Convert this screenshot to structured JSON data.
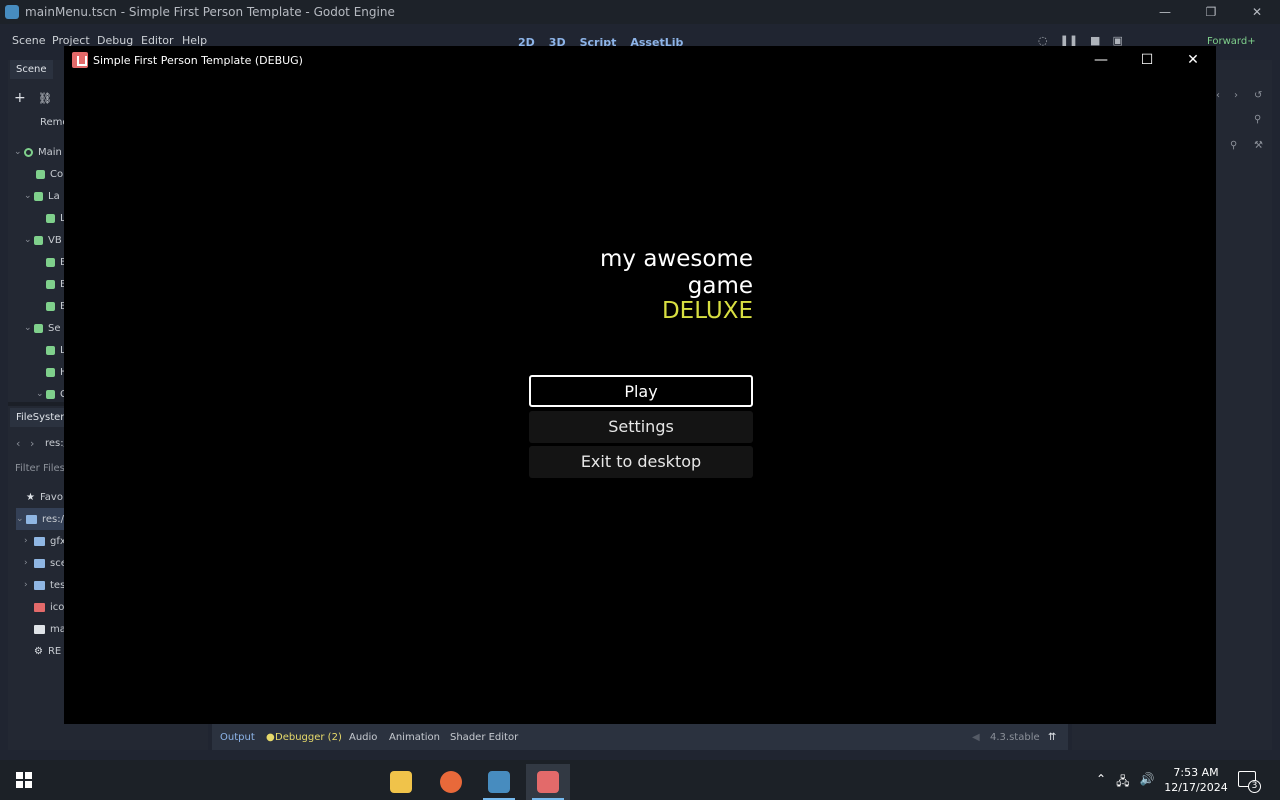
{
  "editor": {
    "title": "mainMenu.tscn - Simple First Person Template - Godot Engine",
    "window_controls": [
      "—",
      "❐",
      "✕"
    ],
    "menus": [
      "Scene",
      "Project",
      "Debug",
      "Editor",
      "Help"
    ],
    "main_screens": [
      "2D",
      "3D",
      "Script",
      "AssetLib"
    ],
    "renderer": "Forward+",
    "scene_tab": "Scene",
    "scene_toolbar_label": "Remo",
    "scene_tree": [
      {
        "label": "Main",
        "color": "#7fd08c"
      },
      {
        "label": "Co",
        "color": "#7fd08c"
      },
      {
        "label": "La",
        "color": "#7fd08c"
      },
      {
        "label": "L",
        "color": "#7fd08c"
      },
      {
        "label": "VB",
        "color": "#7fd08c"
      },
      {
        "label": "B",
        "color": "#7fd08c"
      },
      {
        "label": "B",
        "color": "#7fd08c"
      },
      {
        "label": "B",
        "color": "#7fd08c"
      },
      {
        "label": "Se",
        "color": "#7fd08c"
      },
      {
        "label": "L",
        "color": "#7fd08c"
      },
      {
        "label": "H",
        "color": "#7fd08c"
      },
      {
        "label": "C",
        "color": "#7fd08c"
      }
    ],
    "filesystem_tab": "FileSystem",
    "filesystem_path": "res:/",
    "filter_placeholder": "Filter Files",
    "filesystem": [
      "Favo",
      "res://",
      "gfx",
      "sce",
      "tes",
      "ico",
      "ma",
      "RE"
    ],
    "bottom_tabs": [
      "Output",
      "Debugger (2)",
      "Audio",
      "Animation",
      "Shader Editor"
    ],
    "version": "4.3.stable"
  },
  "game_window": {
    "title": "Simple First Person Template (DEBUG)",
    "controls": [
      "—",
      "☐",
      "✕"
    ],
    "game_title": "my awesome game",
    "game_subtitle": "DELUXE",
    "buttons": {
      "play": "Play",
      "settings": "Settings",
      "exit": "Exit to desktop"
    },
    "subtitle_color": "#d8df41"
  },
  "taskbar": {
    "time": "7:53 AM",
    "date": "12/17/2024",
    "notifications": "3"
  }
}
